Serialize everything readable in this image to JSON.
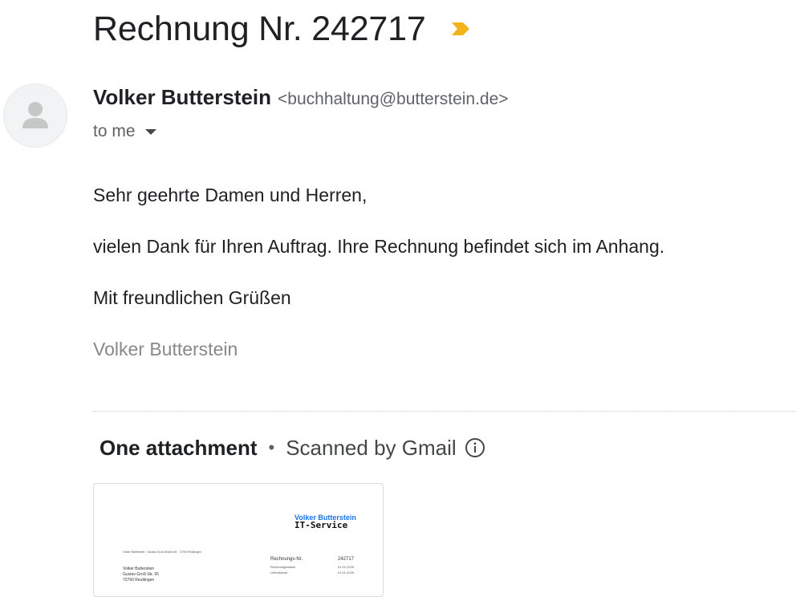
{
  "email": {
    "subject": "Rechnung Nr. 242717",
    "sender": {
      "name": "Volker Butterstein",
      "email": "<buchhaltung@butterstein.de>"
    },
    "recipient_label": "to me",
    "body": {
      "greeting": "Sehr geehrte Damen und Herren,",
      "message": "vielen Dank für Ihren Auftrag. Ihre Rechnung befindet sich im Anhang.",
      "closing": "Mit freundlichen Grüßen",
      "signature": "Volker Butterstein"
    }
  },
  "attachments": {
    "count_label": "One attachment",
    "separator": "•",
    "scan_label": "Scanned by Gmail",
    "items": [
      {
        "preview": {
          "company_line1": "Volker Butterstein",
          "company_line2": "IT-Service",
          "sender_line": "Volker Butterstein · Gustav-Groß-Straße 65 · 72760 Reutlingen",
          "address_lines": [
            "Volker Butterstein",
            "Gustav-Groß-Str. 65",
            "72760 Reutlingen"
          ],
          "invoice_no_label": "Rechnungs-Nr.",
          "invoice_no": "242717",
          "invoice_date_label": "Rechnungsdatum",
          "invoice_date": "01.01.2025",
          "delivery_date_label": "Lieferdatum",
          "delivery_date": "01.01.2025"
        }
      }
    ]
  },
  "icons": {
    "importance": "importance-marker-icon",
    "avatar": "default-person-icon",
    "expand": "caret-down-icon",
    "info": "info-icon"
  },
  "colors": {
    "importance_marker": "#f2b31b",
    "logo_blue": "#1a73e8",
    "text_primary": "#202124",
    "text_secondary": "#5f6368",
    "signature_gray": "#888888"
  }
}
